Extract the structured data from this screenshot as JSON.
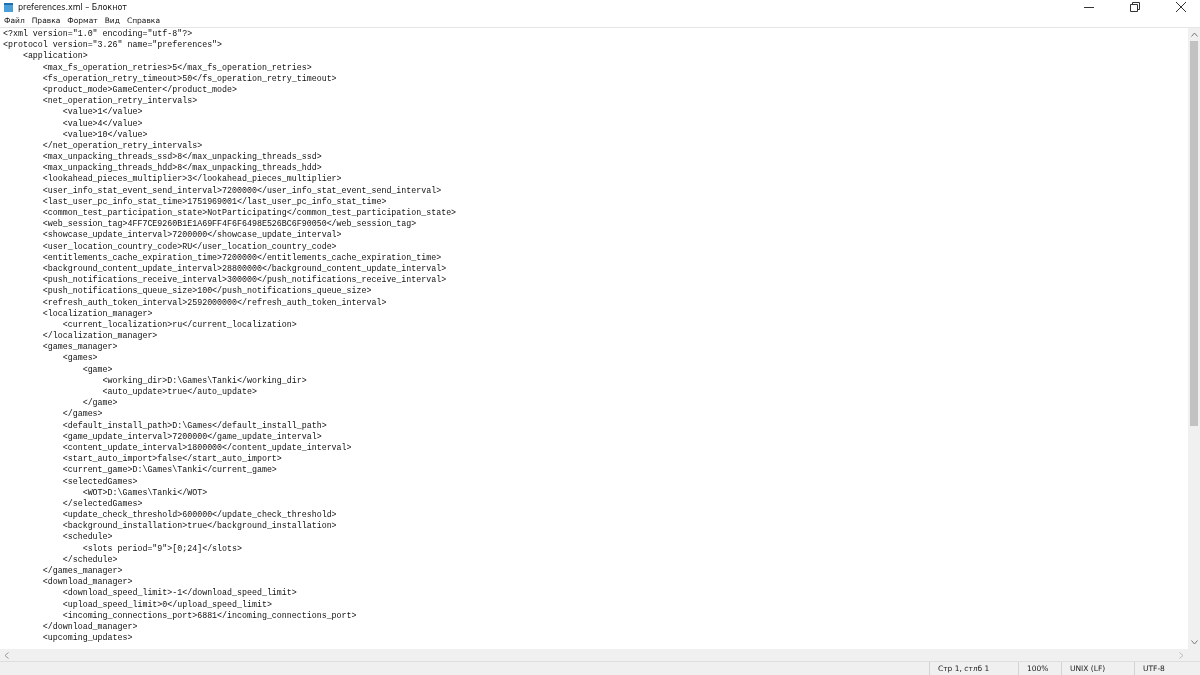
{
  "window": {
    "title": "preferences.xml – Блокнот"
  },
  "menu": [
    "Файл",
    "Правка",
    "Формат",
    "Вид",
    "Справка"
  ],
  "lines": [
    "<?xml version=\"1.0\" encoding=\"utf-8\"?>",
    "<protocol version=\"3.26\" name=\"preferences\">",
    "    <application>",
    "        <max_fs_operation_retries>5</max_fs_operation_retries>",
    "        <fs_operation_retry_timeout>50</fs_operation_retry_timeout>",
    "        <product_mode>GameCenter</product_mode>",
    "        <net_operation_retry_intervals>",
    "            <value>1</value>",
    "            <value>4</value>",
    "            <value>10</value>",
    "        </net_operation_retry_intervals>",
    "        <max_unpacking_threads_ssd>8</max_unpacking_threads_ssd>",
    "        <max_unpacking_threads_hdd>8</max_unpacking_threads_hdd>",
    "        <lookahead_pieces_multiplier>3</lookahead_pieces_multiplier>",
    "        <user_info_stat_event_send_interval>7200000</user_info_stat_event_send_interval>",
    "        <last_user_pc_info_stat_time>1751969001</last_user_pc_info_stat_time>",
    "        <common_test_participation_state>NotParticipating</common_test_participation_state>",
    "        <web_session_tag>4FF7CE9260B1E1A69FF4F6F6498E526BC6F90050</web_session_tag>",
    "        <showcase_update_interval>7200000</showcase_update_interval>",
    "        <user_location_country_code>RU</user_location_country_code>",
    "        <entitlements_cache_expiration_time>7200000</entitlements_cache_expiration_time>",
    "        <background_content_update_interval>28800000</background_content_update_interval>",
    "        <push_notifications_receive_interval>300000</push_notifications_receive_interval>",
    "        <push_notifications_queue_size>100</push_notifications_queue_size>",
    "        <refresh_auth_token_interval>2592000000</refresh_auth_token_interval>",
    "        <localization_manager>",
    "            <current_localization>ru</current_localization>",
    "        </localization_manager>",
    "        <games_manager>",
    "            <games>",
    "                <game>",
    "                    <working_dir>D:\\Games\\Tanki</working_dir>",
    "                    <auto_update>true</auto_update>",
    "                </game>",
    "            </games>",
    "            <default_install_path>D:\\Games</default_install_path>",
    "            <game_update_interval>7200000</game_update_interval>",
    "            <content_update_interval>1800000</content_update_interval>",
    "            <start_auto_import>false</start_auto_import>",
    "            <current_game>D:\\Games\\Tanki</current_game>",
    "            <selectedGames>",
    "                <WOT>D:\\Games\\Tanki</WOT>",
    "            </selectedGames>",
    "            <update_check_threshold>600000</update_check_threshold>",
    "            <background_installation>true</background_installation>",
    "            <schedule>",
    "                <slots period=\"9\">[0;24]</slots>",
    "            </schedule>",
    "        </games_manager>",
    "        <download_manager>",
    "            <download_speed_limit>-1</download_speed_limit>",
    "            <upload_speed_limit>0</upload_speed_limit>",
    "            <incoming_connections_port>6881</incoming_connections_port>",
    "        </download_manager>",
    "        <upcoming_updates>"
  ],
  "status_bar": {
    "position": "Стр 1, стлб 1",
    "zoom": "100%",
    "line_ending": "UNIX (LF)",
    "encoding": "UTF-8"
  }
}
